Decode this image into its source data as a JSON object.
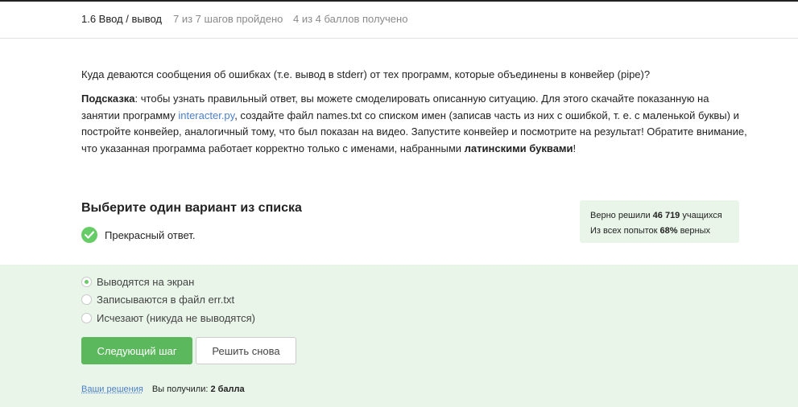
{
  "header": {
    "step_title": "1.6 Ввод / вывод",
    "steps_passed": "7 из 7 шагов пройдено",
    "points_got": "4 из 4 баллов  получено"
  },
  "question": {
    "text": "Куда деваются сообщения об ошибках (т.е. вывод в stderr) от тех программ, которые объединены в конвейер (pipe)?"
  },
  "hint": {
    "label": "Подсказка",
    "part1": ": чтобы узнать правильный ответ, вы можете смоделировать описанную ситуацию. Для этого скачайте показанную на занятии программу ",
    "link": "interacter.py",
    "part2": ", создайте файл names.txt со списком имен (записав часть из них с ошибкой, т. е. с маленькой буквы) и постройте конвейер, аналогичный тому, что был показан на видео. Запустите конвейер и посмотрите на результат! Обратите внимание, что указанная программа работает корректно только с именами, набранными ",
    "bold_end": "латинскими буквами",
    "tail": "!"
  },
  "quiz": {
    "title": "Выберите один вариант из списка",
    "feedback": "Прекрасный ответ."
  },
  "stats": {
    "solved_prefix": "Верно решили ",
    "solved_count": "46 719",
    "solved_suffix": " учащихся",
    "attempts_prefix": "Из всех попыток ",
    "attempts_percent": "68%",
    "attempts_suffix": " верных"
  },
  "options": [
    {
      "label": "Выводятся на экран",
      "selected": true
    },
    {
      "label": "Записываются в файл err.txt",
      "selected": false
    },
    {
      "label": "Исчезают (никуда не выводятся)",
      "selected": false
    }
  ],
  "buttons": {
    "next": "Следующий шаг",
    "retry": "Решить снова"
  },
  "footer": {
    "your_solutions": "Ваши решения",
    "received_prefix": "Вы получили: ",
    "received_value": "2 балла"
  },
  "colors": {
    "accent_green": "#5cb85c",
    "answer_bg": "#e9f5e9",
    "link": "#4b7fcb"
  }
}
